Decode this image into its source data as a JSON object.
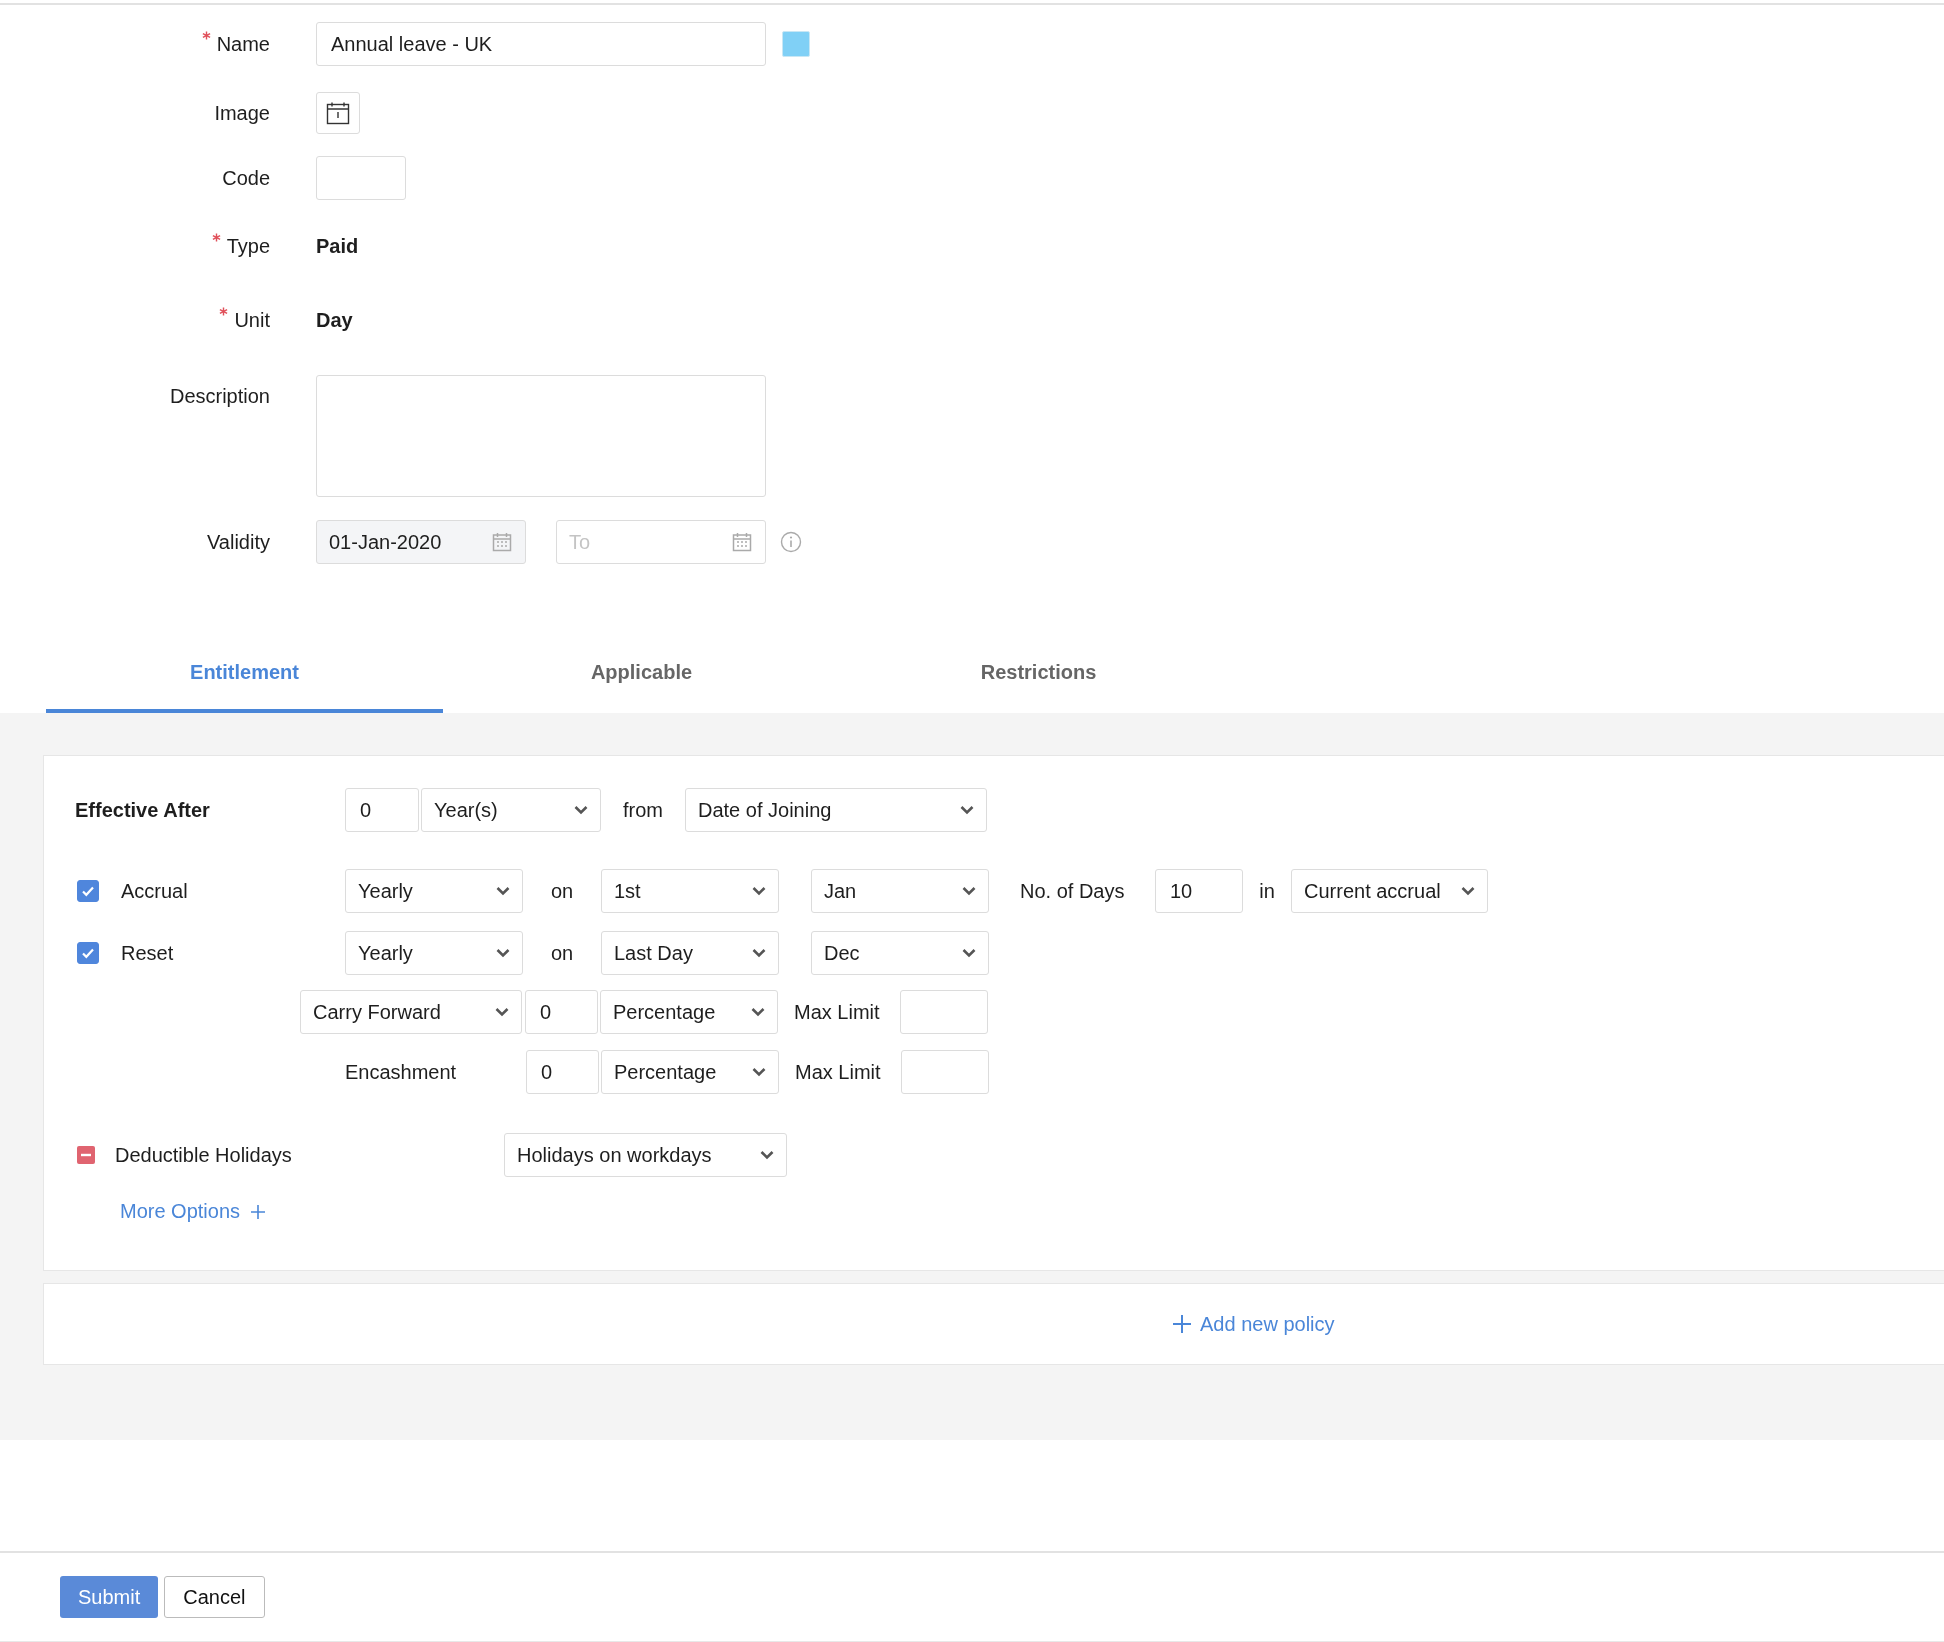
{
  "form": {
    "fields": [
      {
        "kind": "input",
        "label": "Name",
        "required": true,
        "value": "Annual leave - UK",
        "color": "#80d0f6"
      },
      {
        "kind": "image",
        "label": "Image",
        "required": false
      },
      {
        "kind": "code",
        "label": "Code",
        "required": false
      },
      {
        "kind": "static",
        "label": "Type",
        "required": true,
        "value": "Paid"
      },
      {
        "kind": "static",
        "label": "Unit",
        "required": true,
        "value": "Day"
      },
      {
        "kind": "textarea",
        "label": "Description",
        "required": false
      },
      {
        "kind": "daterange",
        "label": "Validity",
        "required": false,
        "from": "01-Jan-2020",
        "to": {
          "placeholder": "To"
        }
      }
    ]
  },
  "tabs": [
    {
      "label": "Entitlement",
      "selected": true
    },
    {
      "label": "Applicable",
      "selected": false
    },
    {
      "label": "Restrictions",
      "selected": false
    }
  ],
  "entitlement": {
    "effective_after": {
      "label": "Effective After",
      "value": "0",
      "unit": "Year(s)",
      "from_label": "from",
      "from": "Date of Joining"
    },
    "periodic": [
      {
        "label": "Accrual",
        "checked": true,
        "frequency": "Yearly",
        "on_label": "on",
        "day": "1st",
        "month": "Jan",
        "days_label": "No. of Days",
        "days": "10",
        "in_label": "in",
        "period": "Current accrual"
      },
      {
        "label": "Reset",
        "checked": true,
        "frequency": "Yearly",
        "on_label": "on",
        "day": "Last Day",
        "month": "Dec"
      }
    ],
    "carry_rows": [
      {
        "kind": "dropdown",
        "label": "Carry Forward",
        "value": "0",
        "unit": "Percentage",
        "limit_label": "Max Limit"
      },
      {
        "kind": "text",
        "label": "Encashment",
        "value": "0",
        "unit": "Percentage",
        "limit_label": "Max Limit"
      }
    ],
    "deductible": {
      "label": "Deductible Holidays",
      "value": "Holidays on workdays"
    },
    "more_options": "More Options"
  },
  "add_policy": "Add new policy",
  "buttons": [
    {
      "label": "Submit",
      "kind": "primary"
    },
    {
      "label": "Cancel",
      "kind": "secondary"
    }
  ]
}
